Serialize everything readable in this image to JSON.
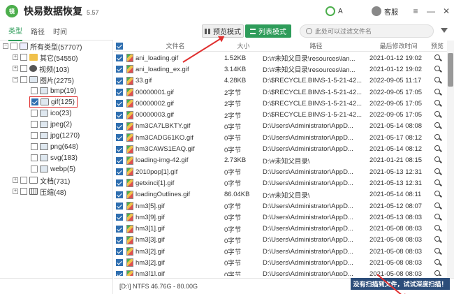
{
  "app": {
    "logo_text": "镜",
    "title": "快易数据恢复",
    "version": "5.57",
    "user": "A",
    "service": "客服"
  },
  "window_controls": {
    "menu": "≡",
    "minimize": "—",
    "close": "✕"
  },
  "left_tabs": [
    "类型",
    "路径",
    "时间"
  ],
  "tree": {
    "all": "所有类型(57707)",
    "other": "其它(54550)",
    "video": "视频(103)",
    "images": "图片(2275)",
    "bmp": "bmp(19)",
    "gif": "gif(125)",
    "ico": "ico(23)",
    "jpeg": "jpeg(2)",
    "jpg": "jpg(1270)",
    "png": "png(648)",
    "svg": "svg(183)",
    "webp": "webp(5)",
    "docs": "文档(731)",
    "archives": "压缩(48)"
  },
  "toolbar": {
    "preview_mode": "预览模式",
    "list_mode": "列表模式",
    "search_placeholder": "此处可以过滤文件名"
  },
  "columns": {
    "name": "文件名",
    "size": "大小",
    "path": "路径",
    "date": "最后修改时间",
    "preview": "预览"
  },
  "rows": [
    {
      "name": "ani_loading.gif",
      "size": "1.52KB",
      "path": "D:\\#未知父目录\\resources\\lan...",
      "date": "2021-01-12  19:02"
    },
    {
      "name": "ani_loading_ex.gif",
      "size": "3.14KB",
      "path": "D:\\#未知父目录\\resources\\lan...",
      "date": "2021-01-12  19:02"
    },
    {
      "name": "33.gif",
      "size": "4.28KB",
      "path": "D:\\$RECYCLE.BIN\\S-1-5-21-42...",
      "date": "2022-09-05  11:17"
    },
    {
      "name": "00000001.gif",
      "size": "2字节",
      "path": "D:\\$RECYCLE.BIN\\S-1-5-21-42...",
      "date": "2022-09-05  17:05"
    },
    {
      "name": "00000002.gif",
      "size": "2字节",
      "path": "D:\\$RECYCLE.BIN\\S-1-5-21-42...",
      "date": "2022-09-05  17:05"
    },
    {
      "name": "00000003.gif",
      "size": "2字节",
      "path": "D:\\$RECYCLE.BIN\\S-1-5-21-42...",
      "date": "2022-09-05  17:05"
    },
    {
      "name": "hm3CA7LBKTY.gif",
      "size": "0字节",
      "path": "D:\\Users\\Administrator\\AppD...",
      "date": "2021-05-14  08:08"
    },
    {
      "name": "hm3CADG61KO.gif",
      "size": "0字节",
      "path": "D:\\Users\\Administrator\\AppD...",
      "date": "2021-05-17  08:12"
    },
    {
      "name": "hm3CAWS1EAQ.gif",
      "size": "0字节",
      "path": "D:\\Users\\Administrator\\AppD...",
      "date": "2021-05-14  08:12"
    },
    {
      "name": "loading-img-42.gif",
      "size": "2.73KB",
      "path": "D:\\#未知父目录\\",
      "date": "2021-01-21  08:15"
    },
    {
      "name": "2010pop[1].gif",
      "size": "0字节",
      "path": "D:\\Users\\Administrator\\AppD...",
      "date": "2021-05-13  12:31"
    },
    {
      "name": "getxinci[1].gif",
      "size": "0字节",
      "path": "D:\\Users\\Administrator\\AppD...",
      "date": "2021-05-13  12:31"
    },
    {
      "name": "loadingOutlines.gif",
      "size": "86.04KB",
      "path": "D:\\#未知父目录\\",
      "date": "2021-05-14  08:11"
    },
    {
      "name": "hm3[5].gif",
      "size": "0字节",
      "path": "D:\\Users\\Administrator\\AppD...",
      "date": "2021-05-12  08:07"
    },
    {
      "name": "hm3[9].gif",
      "size": "0字节",
      "path": "D:\\Users\\Administrator\\AppD...",
      "date": "2021-05-13  08:03"
    },
    {
      "name": "hm3[1].gif",
      "size": "0字节",
      "path": "D:\\Users\\Administrator\\AppD...",
      "date": "2021-05-08  08:03"
    },
    {
      "name": "hm3[3].gif",
      "size": "0字节",
      "path": "D:\\Users\\Administrator\\AppD...",
      "date": "2021-05-08  08:03"
    },
    {
      "name": "hm3[2].gif",
      "size": "0字节",
      "path": "D:\\Users\\Administrator\\AppD...",
      "date": "2021-05-08  08:03"
    },
    {
      "name": "hm3[2].gif",
      "size": "0字节",
      "path": "D:\\Users\\Administrator\\AppD...",
      "date": "2021-05-08  08:03"
    },
    {
      "name": "hm3[1].gif",
      "size": "0字节",
      "path": "D:\\Users\\Administrator\\AppD...",
      "date": "2021-05-08  08:03"
    }
  ],
  "status": {
    "drive": "[D:\\]  NTFS  46.76G - 80.00G",
    "deep_scan": "没有扫描到文件，试试深度扫描！"
  }
}
